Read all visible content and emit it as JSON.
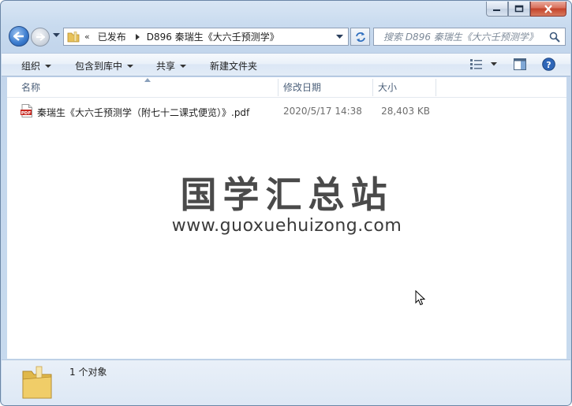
{
  "window": {
    "caption": {
      "minimize": "minimize",
      "maximize": "maximize",
      "close": "close"
    }
  },
  "nav": {
    "address": {
      "chevron": "«",
      "crumbs": [
        "已发布",
        "D896 秦瑞生《大六壬预测学》"
      ]
    },
    "search": {
      "placeholder": "搜索 D896 秦瑞生《大六壬预测学》"
    }
  },
  "toolbar": {
    "organize": "组织",
    "include_in_library": "包含到库中",
    "share": "共享",
    "new_folder": "新建文件夹"
  },
  "columns": {
    "name": "名称",
    "modified": "修改日期",
    "size": "大小"
  },
  "files": [
    {
      "name": "秦瑞生《大六壬预测学（附七十二课式便览）》.pdf",
      "modified": "2020/5/17 14:38",
      "size": "28,403 KB",
      "icon": "pdf-icon"
    }
  ],
  "watermark": {
    "cn": "国学汇总站",
    "url": "www.guoxuehuizong.com"
  },
  "details": {
    "count": "1 个对象"
  },
  "colors": {
    "accent": "#3f7fd0",
    "pdf_red": "#c8271f",
    "folder": "#e8c25a"
  }
}
